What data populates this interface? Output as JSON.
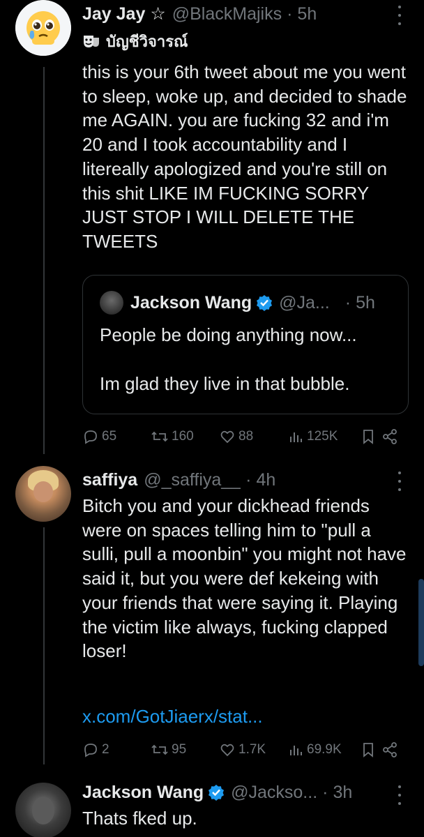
{
  "colors": {
    "background": "#000000",
    "text": "#e7e9ea",
    "muted": "#71767b",
    "link": "#1d9bf0",
    "verified": "#1d9bf0"
  },
  "tweet1": {
    "name": "Jay Jay ☆",
    "handle": "@BlackMajiks",
    "dot": "·",
    "time": "5h",
    "label_icon": "theater-mask-icon",
    "label": "บัญชีวิจารณ์",
    "text": "this is your 6th tweet about me you went to sleep, woke up, and decided to shade me AGAIN. you are fucking 32 and i'm 20 and I took accountability and I litereally apologized and you're still on this shit LIKE IM FUCKING SORRY JUST STOP I WILL DELETE THE TWEETS",
    "quote": {
      "name": "Jackson Wang",
      "handle": "@Ja...",
      "dot": "·",
      "time": "5h",
      "line1": "People be doing anything now...",
      "line2": "Im glad they live in that bubble."
    },
    "stats": {
      "replies": "65",
      "retweets": "160",
      "likes": "88",
      "views": "125K"
    }
  },
  "tweet2": {
    "name": "saffiya",
    "handle": "@_saffiya__",
    "dot": "·",
    "time": "4h",
    "text": "Bitch you and your dickhead friends were on spaces telling him to \"pull a sulli, pull a moonbin\" you might not have said it, but you were def kekeing with your friends that were saying it. Playing the victim like always, fucking clapped loser!",
    "link": "x.com/GotJiaerx/stat...",
    "stats": {
      "replies": "2",
      "retweets": "95",
      "likes": "1.7K",
      "views": "69.9K"
    }
  },
  "tweet3": {
    "name": "Jackson Wang",
    "handle": "@Jackso...",
    "dot": "·",
    "time": "3h",
    "text": "Thats fked up."
  }
}
